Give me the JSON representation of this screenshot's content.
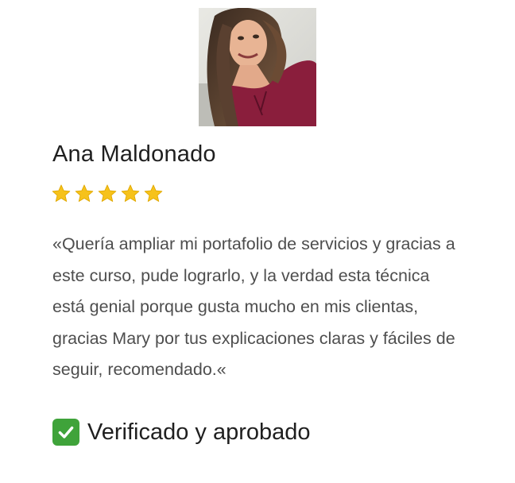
{
  "review": {
    "reviewer_name": "Ana Maldonado",
    "rating": 5,
    "rating_max": 5,
    "star_icon": "star-icon",
    "star_color": "#f6c21b",
    "quote": "«Quería ampliar mi portafolio de servicios y gracias a este curso, pude lograrlo, y la verdad esta técnica está genial porque gusta mucho en mis clientas, gracias Mary por tus explicaciones claras y fáciles de seguir, recomendado.«",
    "verified_icon": "check-mark-icon",
    "verified_color": "#3fa33a",
    "verified_label": "Verificado y aprobado"
  }
}
